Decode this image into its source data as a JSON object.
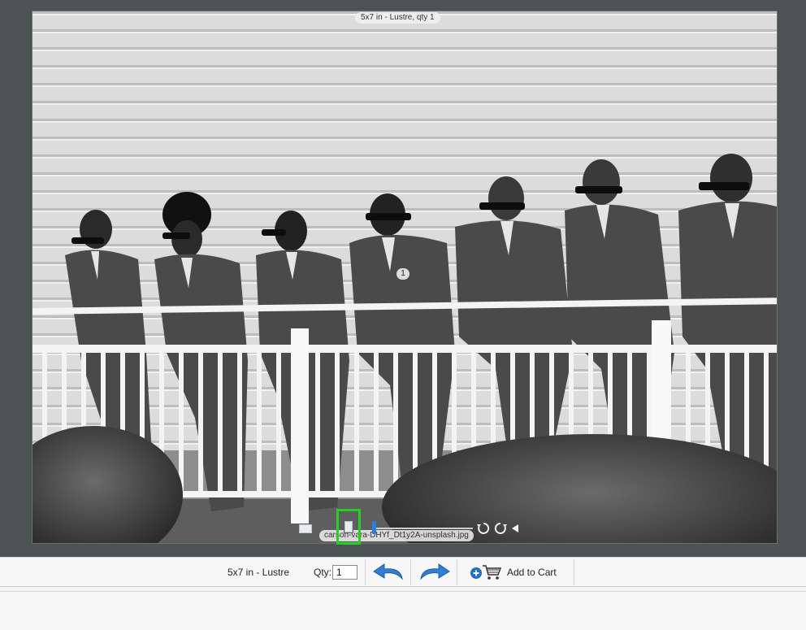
{
  "photo": {
    "size_label": "5x7 in - Lustre, qty 1",
    "index_badge": "1",
    "filename": "carson-vara-DHYf_Dt1y2A-unsplash.jpg",
    "zoom_fraction": 0.0
  },
  "toolbar": {
    "product_label": "5x7 in - Lustre",
    "qty_label": "Qty:",
    "qty_value": "1",
    "add_to_cart_label": "Add to Cart"
  },
  "colors": {
    "viewer_bg": "#4d5252",
    "selection_highlight": "#22d122",
    "accent_blue": "#2a7de1"
  },
  "icons": {
    "landscape": "landscape-orientation-icon",
    "portrait": "portrait-orientation-icon",
    "rotate_left": "rotate-left-icon",
    "rotate_right": "rotate-right-icon",
    "previous": "triangle-left-icon",
    "undo": "undo-arrow-icon",
    "redo": "redo-arrow-icon",
    "cart": "add-to-cart-icon"
  }
}
